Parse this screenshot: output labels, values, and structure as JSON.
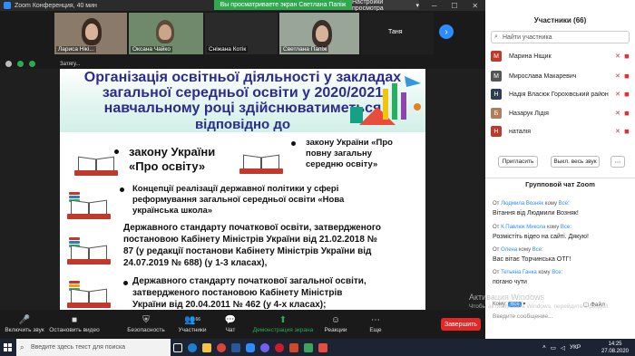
{
  "window": {
    "title": "Zoom Конференция, 40 мин"
  },
  "banner": {
    "viewing": "Вы просматриваете экран Светлана Папіж",
    "view_options": "Настройки просмотра"
  },
  "thumbnails": [
    {
      "name": "Лариса Нікі..."
    },
    {
      "name": "Оксана Чайко"
    },
    {
      "name": "Сніжана Котік"
    },
    {
      "name": "Светлана Папіж"
    },
    {
      "name": "Таня"
    }
  ],
  "share_bar": {
    "caption": "Затягу..."
  },
  "slide": {
    "title_lines": [
      "Організація освітньої діяльності у закладах",
      "загальної середньої освіти у 2020/2021",
      "навчальному році здійснюватиметься",
      "відповідно до"
    ],
    "items": [
      {
        "text1": "закону України",
        "text2": "«Про освіту»"
      },
      {
        "text1": "закону України «Про",
        "text2": "повну загальну",
        "text3": "середню освіту»"
      },
      {
        "text1": "Концепції реалізації державної політики у сфері",
        "text2": "реформування загальної середньої освіти «Нова",
        "text3": "українська школа»"
      },
      {
        "text1": "Державного стандарту початкової освіти, затвердженого",
        "text2": "постановою Кабінету Міністрів України від 21.02.2018 №",
        "text3": "87 (у редакції постанови Кабінету Міністрів України від",
        "text4": "24.07.2019 № 688) (у 1-3 класах),"
      },
      {
        "text1": "Державного стандарту початкової загальної освіти,",
        "text2": "затвердженого постановою Кабінету Міністрів",
        "text3": "України від 20.04.2011 № 462 (у 4-х класах);"
      }
    ]
  },
  "toolbar": {
    "mute": "Включить звук",
    "stop_video": "Остановить видео",
    "security": "Безопасность",
    "participants": "Участники",
    "participants_count": "66",
    "chat": "Чат",
    "share": "Демонстрация экрана",
    "reactions": "Реакции",
    "more": "Еще",
    "end": "Завершить"
  },
  "panel": {
    "title": "Участники (66)",
    "search_placeholder": "Найти участника",
    "participants": [
      {
        "initial": "М",
        "name": "Марина Ніщик",
        "color": "#c0392b"
      },
      {
        "initial": "М",
        "name": "Мирослава Макаревич",
        "color": "#555555"
      },
      {
        "initial": "Н",
        "name": "Надія Власюк Горохівський район",
        "color": "#2c3e50"
      },
      {
        "initial": "Б",
        "name": "Назарук Лідія",
        "color": "#b07d56"
      },
      {
        "initial": "Н",
        "name": "наталія",
        "color": "#c0392b"
      }
    ],
    "invite": "Пригласить",
    "mute_all": "Выкл. весь звук",
    "chat_title": "Групповой чат Zoom",
    "messages": [
      {
        "from": "Людмила Возняк",
        "to": "Все",
        "text": "Вітання від Людмили Возняк!"
      },
      {
        "from": "К Павлюк Микола",
        "to": "Все",
        "text": "Розмістіть відео  на сайті. Дякую!"
      },
      {
        "from": "Олена",
        "to": "Все",
        "text": "Вас вітає Торчинська ОТГ!"
      },
      {
        "from": "Тетьяна Ганка",
        "to": "Все",
        "text": "погано чути"
      }
    ],
    "chat_to_label": "Кому:",
    "chat_to_value": "Все",
    "chat_input_placeholder": "Введите сообщение...",
    "file_label": "Файл"
  },
  "watermark": {
    "line1": "Активация Windows",
    "line2": "Чтобы активировать Windows, перейдите в раздел"
  },
  "taskbar": {
    "search_placeholder": "Введите здесь текст для поиска",
    "lang": "УКР",
    "time": "14:25",
    "date": "27.08.2020"
  },
  "colors": {
    "zoom_blue": "#2d8cff",
    "end_red": "#e02828",
    "share_green": "#2fa84f",
    "slide_title": "#2c2c8c"
  }
}
